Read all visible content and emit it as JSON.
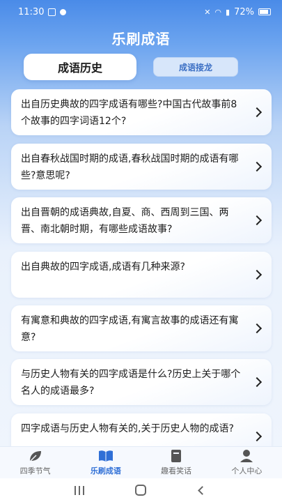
{
  "status": {
    "time": "11:30",
    "battery": "72%"
  },
  "header": {
    "title": "乐刷成语"
  },
  "tabs": {
    "active": "成语历史",
    "other": "成语接龙"
  },
  "questions": [
    "出自历史典故的四字成语有哪些?中国古代故事前8个故事的四字词语12个?",
    "出自春秋战国时期的成语,春秋战国时期的成语有哪些?意思呢?",
    "出自晋朝的成语典故,自夏、商、西周到三国、两晋、南北朝时期，有哪些成语故事?",
    "出自典故的四字成语,成语有几种来源?",
    "有寓意和典故的四字成语,有寓言故事的成语还有寓意?",
    "与历史人物有关的四字成语是什么?历史上关于哪个名人的成语最多?",
    "四字成语与历史人物有关的,关于历史人物的成语?"
  ],
  "nav": [
    {
      "label": "四季节气",
      "icon": "leaf-icon",
      "active": false
    },
    {
      "label": "乐刷成语",
      "icon": "book-icon",
      "active": true
    },
    {
      "label": "趣看笑话",
      "icon": "notebook-icon",
      "active": false
    },
    {
      "label": "个人中心",
      "icon": "person-icon",
      "active": false
    }
  ],
  "colors": {
    "accent": "#2f6fd6",
    "header_top": "#4a8be8"
  }
}
